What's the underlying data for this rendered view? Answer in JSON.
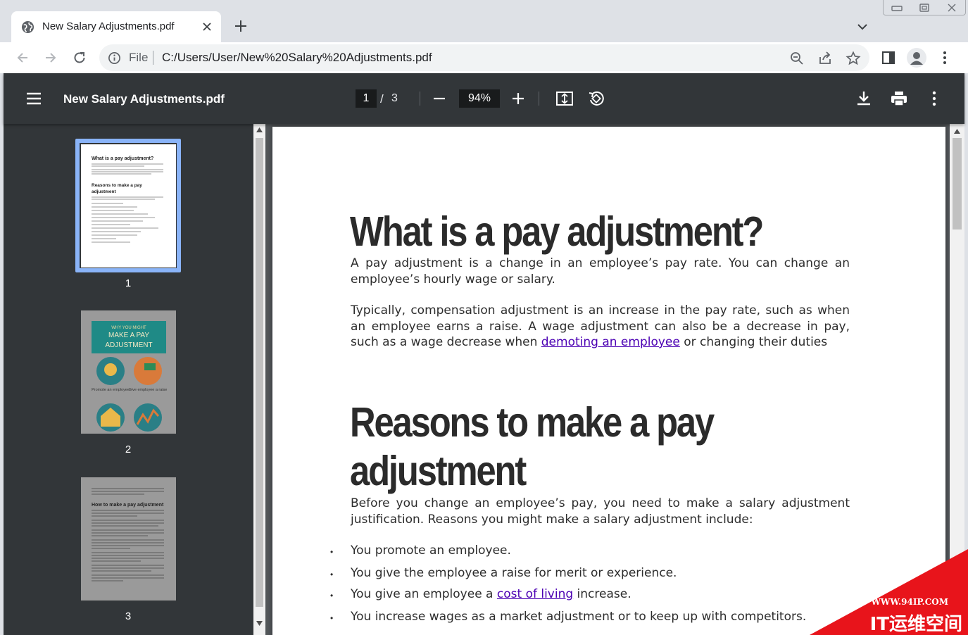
{
  "browser": {
    "tab": {
      "title": "New Salary Adjustments.pdf"
    },
    "omnibox": {
      "scheme": "File",
      "url": "C:/Users/User/New%20Salary%20Adjustments.pdf"
    }
  },
  "viewer": {
    "file_title": "New Salary Adjustments.pdf",
    "current_page": "1",
    "page_separator": "/",
    "total_pages": "3",
    "zoom": "94%"
  },
  "sidebar": {
    "thumbnails": [
      {
        "label": "1",
        "selected": true
      },
      {
        "label": "2",
        "selected": false
      },
      {
        "label": "3",
        "selected": false
      }
    ],
    "thumb1": {
      "heading1": "What is a pay adjustment?",
      "heading2": "Reasons to make a pay adjustment"
    },
    "thumb2": {
      "banner_top": "WHY YOU MIGHT",
      "banner_main": "MAKE A PAY ADJUSTMENT",
      "caption1": "Promote an employee",
      "caption2": "Give employee a raise"
    },
    "thumb3": {
      "heading": "How to make a pay adjustment"
    }
  },
  "document": {
    "heading1": "What is a pay adjustment?",
    "para1": "A pay adjustment is a change in an employee’s pay rate. You can change an employee’s hourly wage or salary.",
    "para2_before": "Typically, compensation adjustment is an increase in the pay rate, such as when an employee earns a raise. A wage adjustment can also be a decrease in pay, such as a wage decrease when ",
    "para2_link": "demoting an employee",
    "para2_after": " or changing their duties",
    "heading2_line1": "Reasons to make a pay",
    "heading2_line2": "adjustment",
    "para3": "Before you change an employee’s pay, you need to make a salary adjustment justification. Reasons you might make a salary adjustment include:",
    "bullet_symbol": "•",
    "bullet1": "You promote an employee.",
    "bullet2": "You give the employee a raise for merit or experience.",
    "bullet3_before": "You give an employee a ",
    "bullet3_link": "cost of living",
    "bullet3_after": " increase.",
    "bullet4": "You increase wages as a market adjustment  or to keep up with competitors."
  },
  "watermark": {
    "url": "WWW.94IP.COM",
    "brand": "IT运维空间"
  },
  "colors": {
    "tabstrip": "#dee1e6",
    "viewer_toolbar": "#323639",
    "document_background": "#525659",
    "link": "#4b00b3",
    "thumb_selected": "#8ab4f8",
    "watermark": "#e8141b"
  }
}
